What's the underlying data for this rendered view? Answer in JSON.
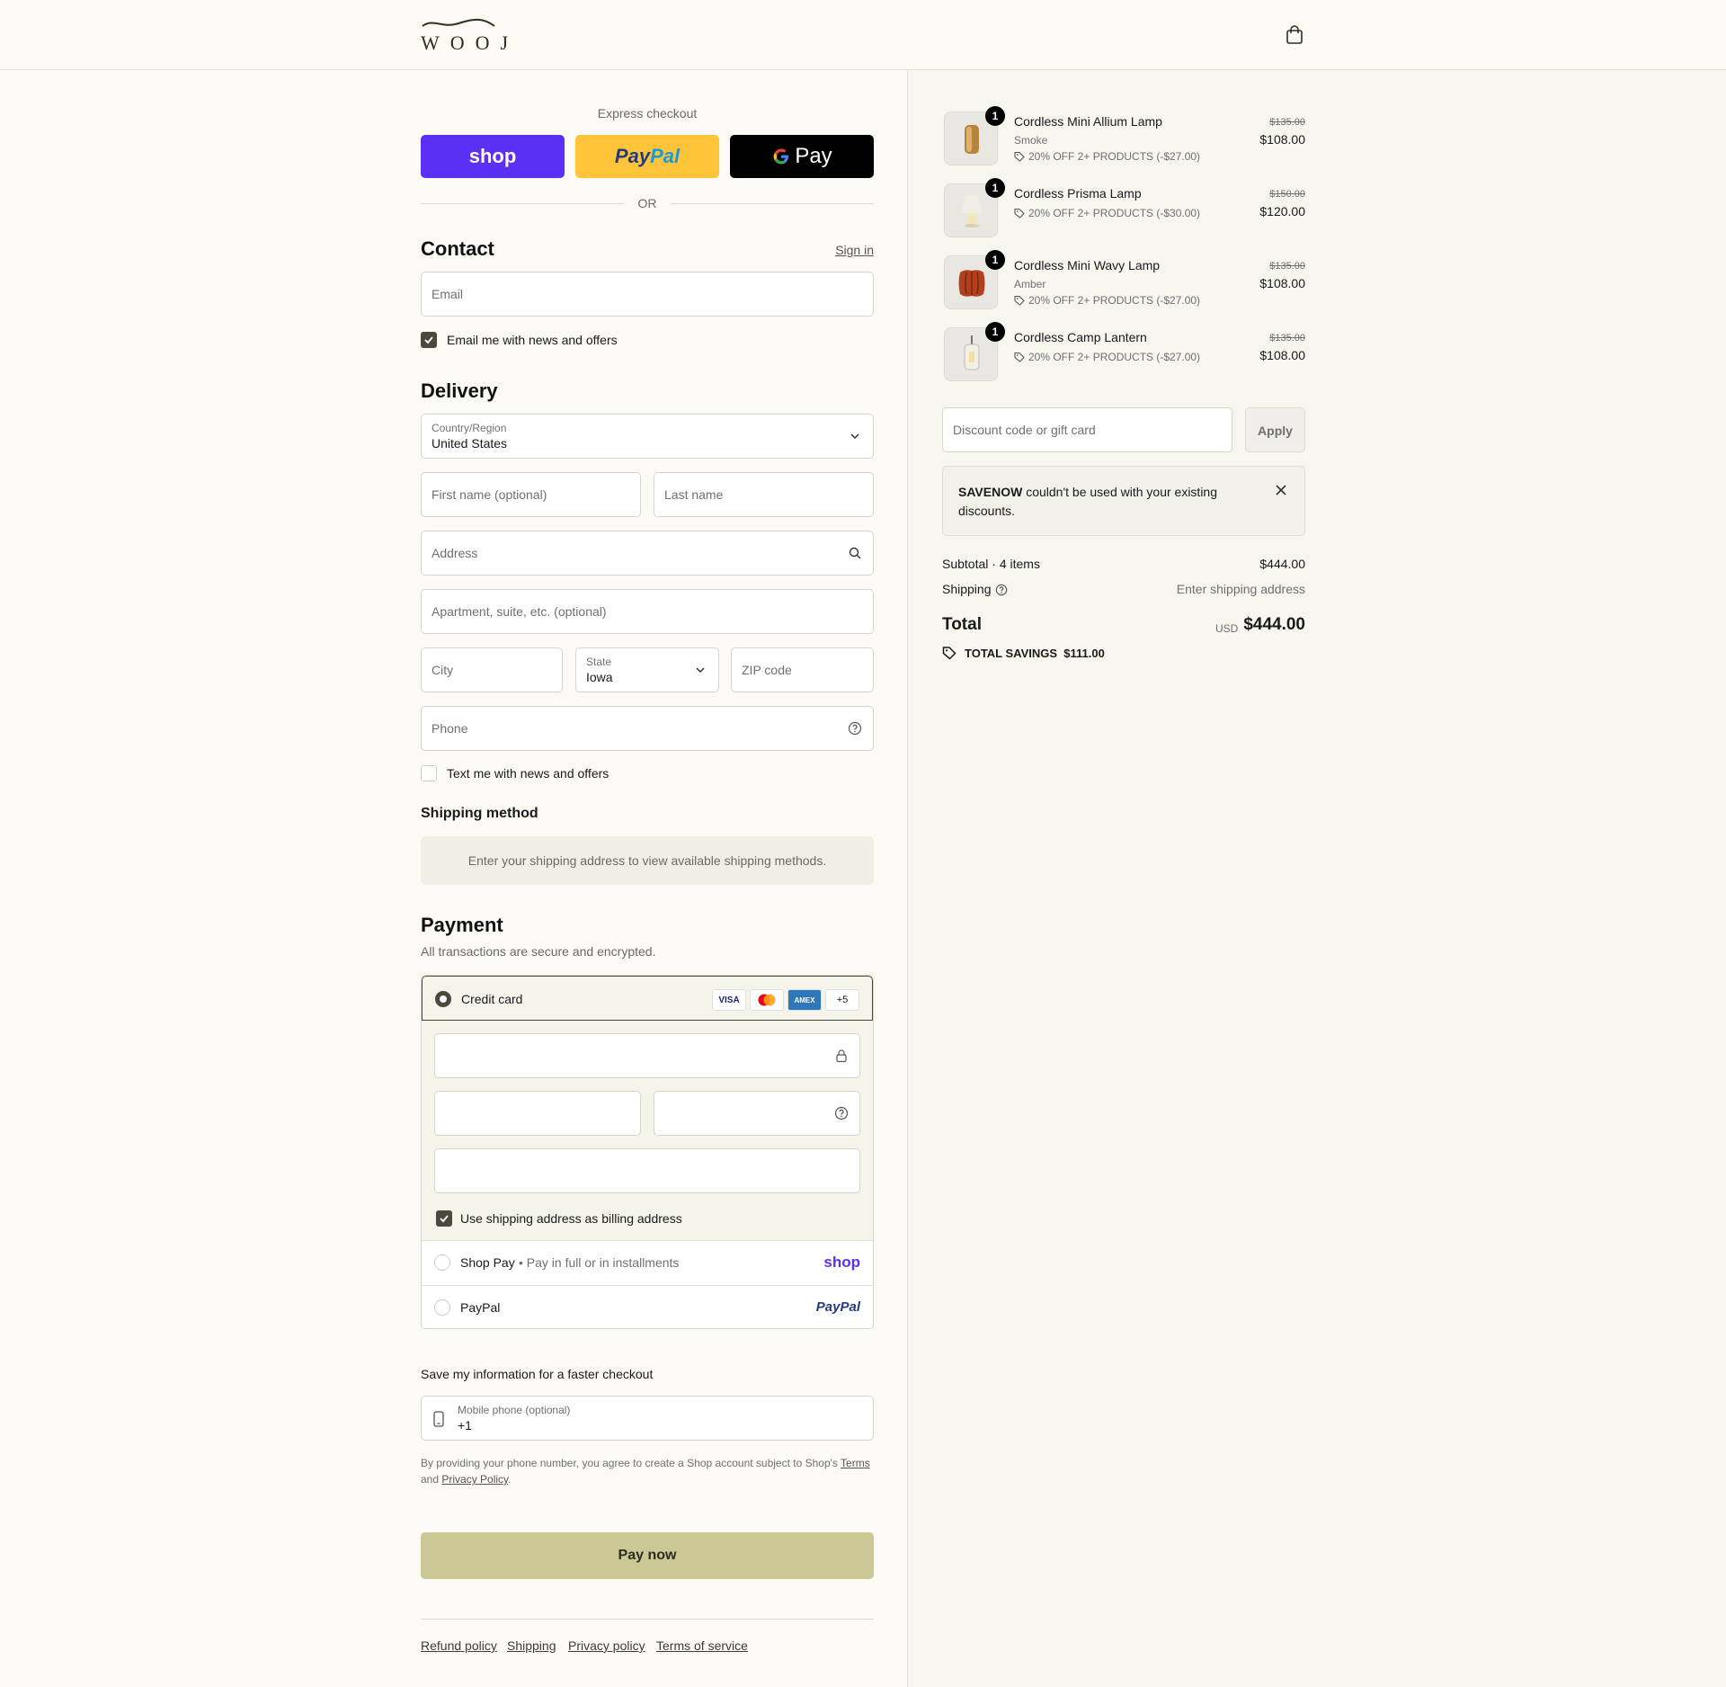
{
  "brand": {
    "logo_text": "WOOJ"
  },
  "express": {
    "title": "Express checkout",
    "shop_label": "shop",
    "paypal_label_a": "Pay",
    "paypal_label_b": "Pal",
    "gpay_label": "Pay",
    "or_label": "OR"
  },
  "contact": {
    "heading": "Contact",
    "sign_in": "Sign in",
    "email_placeholder": "Email",
    "email_news_label": "Email me with news and offers"
  },
  "delivery": {
    "heading": "Delivery",
    "country_label": "Country/Region",
    "country_value": "United States",
    "first_name_placeholder": "First name (optional)",
    "last_name_placeholder": "Last name",
    "address_placeholder": "Address",
    "apartment_placeholder": "Apartment, suite, etc. (optional)",
    "city_placeholder": "City",
    "state_label": "State",
    "state_value": "Iowa",
    "zip_placeholder": "ZIP code",
    "phone_placeholder": "Phone",
    "text_news_label": "Text me with news and offers"
  },
  "shipping_method": {
    "heading": "Shipping method",
    "message": "Enter your shipping address to view available shipping methods."
  },
  "payment": {
    "heading": "Payment",
    "subtitle": "All transactions are secure and encrypted.",
    "credit_card_label": "Credit card",
    "card_badges": [
      "VISA",
      "MC",
      "AMEX",
      "+5"
    ],
    "billing_same_label": "Use shipping address as billing address",
    "shop_pay_label": "Shop Pay",
    "shop_pay_sub": "Pay in full or in installments",
    "shop_pay_logo": "shop",
    "paypal_label": "PayPal",
    "paypal_logo": "PayPal"
  },
  "save_info": {
    "heading": "Save my information for a faster checkout",
    "mobile_label": "Mobile phone (optional)",
    "mobile_value": "+1",
    "terms_text": "By providing your phone number, you agree to create a Shop account subject to Shop's",
    "terms_link": "Terms",
    "and_text": "and",
    "privacy_link": "Privacy Policy",
    "period": "."
  },
  "pay_now_label": "Pay now",
  "footer": [
    "Refund policy",
    "Shipping",
    "Privacy policy",
    "Terms of service"
  ],
  "order": {
    "items": [
      {
        "qty": "1",
        "name": "Cordless Mini Allium Lamp",
        "variant": "Smoke",
        "discount": "20% OFF 2+ PRODUCTS (-$27.00)",
        "old_price": "$135.00",
        "price": "$108.00"
      },
      {
        "qty": "1",
        "name": "Cordless Prisma Lamp",
        "variant": "",
        "discount": "20% OFF 2+ PRODUCTS (-$30.00)",
        "old_price": "$150.00",
        "price": "$120.00"
      },
      {
        "qty": "1",
        "name": "Cordless Mini Wavy Lamp",
        "variant": "Amber",
        "discount": "20% OFF 2+ PRODUCTS (-$27.00)",
        "old_price": "$135.00",
        "price": "$108.00"
      },
      {
        "qty": "1",
        "name": "Cordless Camp Lantern",
        "variant": "",
        "discount": "20% OFF 2+ PRODUCTS (-$27.00)",
        "old_price": "$135.00",
        "price": "$108.00"
      }
    ],
    "discount_placeholder": "Discount code or gift card",
    "apply_label": "Apply",
    "notice_code": "SAVENOW",
    "notice_text": " couldn't be used with your existing discounts.",
    "subtotal_label": "Subtotal · 4 items",
    "subtotal_value": "$444.00",
    "shipping_label": "Shipping",
    "shipping_value": "Enter shipping address",
    "total_label": "Total",
    "currency": "USD",
    "total_value": "$444.00",
    "savings_label": "TOTAL SAVINGS",
    "savings_value": "$111.00"
  },
  "colors": {
    "accent": "#4a4a3c",
    "pay_button": "#cbc896",
    "shop_purple": "#5a31f4",
    "paypal_yellow": "#ffc439"
  }
}
